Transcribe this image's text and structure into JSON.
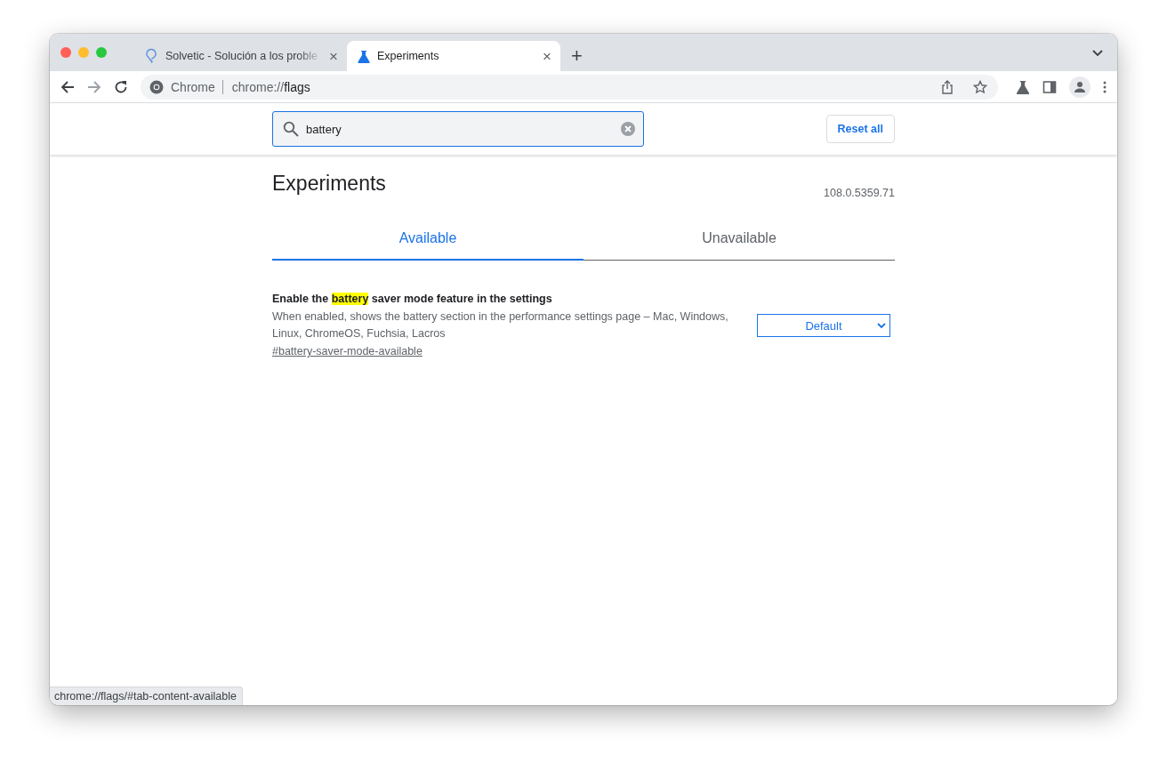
{
  "browser_tabs": [
    {
      "title": "Solvetic - Solución a los proble",
      "kind": "bulb",
      "selected": false,
      "close": "×"
    },
    {
      "title": "Experiments",
      "kind": "flask",
      "selected": true,
      "close": "×"
    }
  ],
  "new_tab": "+",
  "address_bar": {
    "chip": "Chrome",
    "prefix": "chrome://",
    "path": "flags"
  },
  "search": {
    "value": "battery"
  },
  "reset_button": "Reset all",
  "heading": "Experiments",
  "version": "108.0.5359.71",
  "page_tabs": [
    {
      "label": "Available",
      "selected": true
    },
    {
      "label": "Unavailable",
      "selected": false
    }
  ],
  "experiments": [
    {
      "title_parts": [
        {
          "text": "Enable the ",
          "highlighted": false
        },
        {
          "text": "battery",
          "highlighted": true
        },
        {
          "text": " saver mode feature in the settings",
          "highlighted": false
        }
      ],
      "description": "When enabled, shows the battery section in the performance settings page – Mac, Windows, Linux, ChromeOS, Fuchsia, Lacros",
      "link": "#battery-saver-mode-available",
      "value": "Default"
    }
  ],
  "status_bubble": "chrome://flags/#tab-content-available"
}
